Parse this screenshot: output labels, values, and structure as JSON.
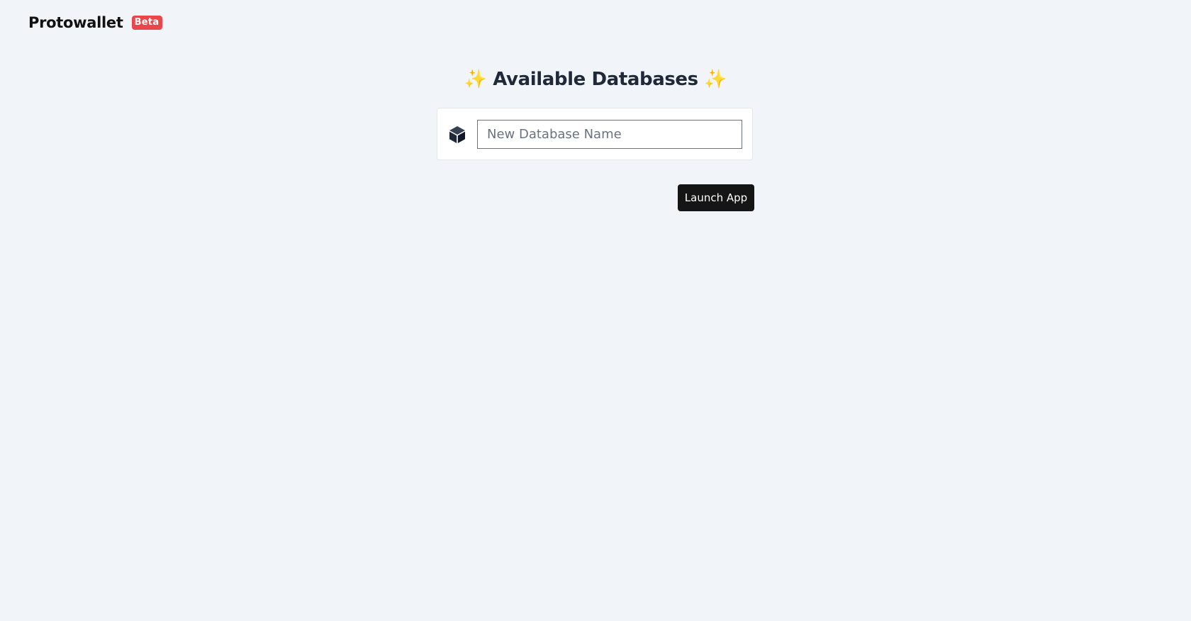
{
  "header": {
    "brand": "Protowallet",
    "badge": "Beta"
  },
  "main": {
    "title_left_icon": "✨",
    "title": "Available Databases",
    "title_right_icon": "✨",
    "new_db": {
      "icon": "cube-icon",
      "placeholder": "New Database Name",
      "value": ""
    },
    "launch_label": "Launch App"
  },
  "colors": {
    "background": "#f1f4f9",
    "badge": "#e9474a",
    "button": "#151515",
    "sparkle": "#f5b301"
  }
}
